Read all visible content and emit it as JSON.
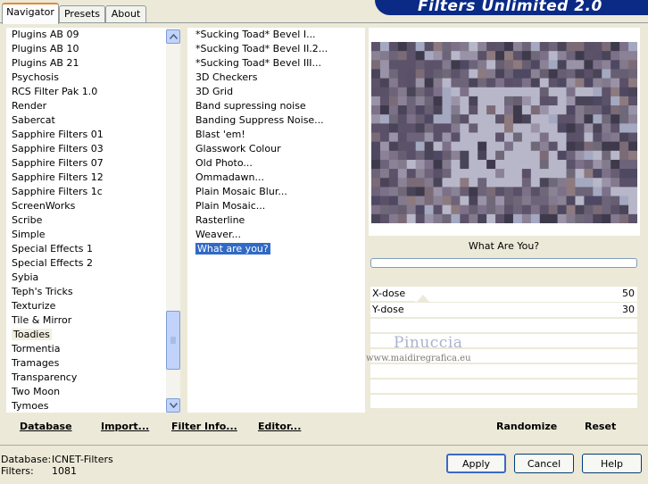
{
  "brand": {
    "title": "Filters Unlimited 2.0"
  },
  "tabs": [
    {
      "label": "Navigator",
      "active": true
    },
    {
      "label": "Presets",
      "active": false
    },
    {
      "label": "About",
      "active": false
    }
  ],
  "categories": {
    "items": [
      "Plugins AB 09",
      "Plugins AB 10",
      "Plugins AB 21",
      "Psychosis",
      "RCS Filter Pak 1.0",
      "Render",
      "Sabercat",
      "Sapphire Filters 01",
      "Sapphire Filters 03",
      "Sapphire Filters 07",
      "Sapphire Filters 12",
      "Sapphire Filters 1c",
      "ScreenWorks",
      "Scribe",
      "Simple",
      "Special Effects 1",
      "Special Effects 2",
      "Sybia",
      "Teph's Tricks",
      "Texturize",
      "Tile & Mirror",
      "Toadies",
      "Tormentia",
      "Tramages",
      "Transparency",
      "Two Moon",
      "Tymoes"
    ],
    "highlighted": "Toadies"
  },
  "filters": {
    "items": [
      "*Sucking Toad*  Bevel I...",
      "*Sucking Toad*  Bevel II.2...",
      "*Sucking Toad*  Bevel III...",
      "3D Checkers",
      "3D Grid",
      "Band supressing noise",
      "Banding Suppress Noise...",
      "Blast 'em!",
      "Glasswork Colour",
      "Old Photo...",
      "Ommadawn...",
      "Plain Mosaic Blur...",
      "Plain Mosaic...",
      "Rasterline",
      "Weaver...",
      "What are you?"
    ],
    "selected": "What are you?"
  },
  "preview": {
    "filter_name": "What Are You?",
    "watermark_name": "Pinuccia",
    "watermark_url": "www.maidiregrafica.eu"
  },
  "params": [
    {
      "label": "X-dose",
      "value": "50"
    },
    {
      "label": "Y-dose",
      "value": "30"
    }
  ],
  "toolbar": {
    "database": "Database",
    "import": "Import...",
    "filter_info": "Filter Info...",
    "editor": "Editor...",
    "randomize": "Randomize",
    "reset": "Reset"
  },
  "status": {
    "database_label": "Database:",
    "database_value": "ICNET-Filters",
    "filters_label": "Filters:",
    "filters_value": "1081"
  },
  "buttons": {
    "apply": "Apply",
    "cancel": "Cancel",
    "help": "Help"
  },
  "colors": {
    "accent_tab": "#e68b2c",
    "selection": "#316ac5",
    "brand_bg": "#0a2a86"
  }
}
